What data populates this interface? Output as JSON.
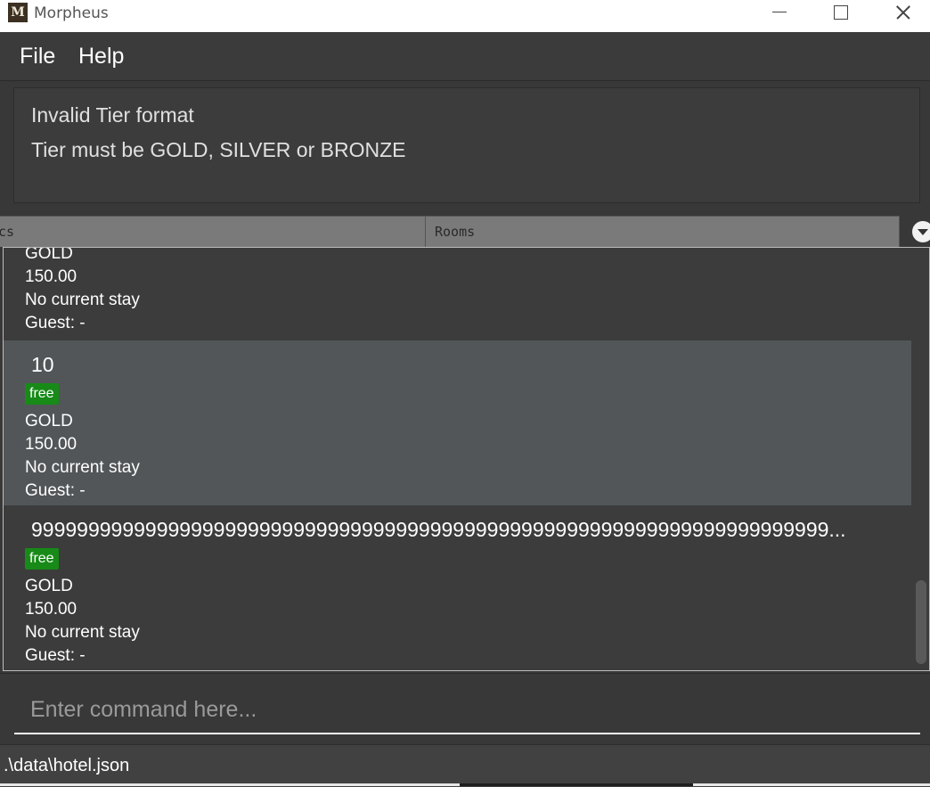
{
  "window": {
    "app_icon_letter": "M",
    "title": "Morpheus"
  },
  "menu": {
    "items": [
      {
        "label": "File"
      },
      {
        "label": "Help"
      }
    ]
  },
  "result": {
    "lines": [
      "Invalid Tier format",
      "Tier must be GOLD, SILVER or BRONZE"
    ]
  },
  "tabs": [
    {
      "label": "cs",
      "selected": false
    },
    {
      "label": "Rooms",
      "selected": true
    }
  ],
  "rooms": [
    {
      "number": "",
      "status": "",
      "tier": "GOLD",
      "price": "150.00",
      "stay": "No current stay",
      "guest": "Guest: -"
    },
    {
      "number": "10",
      "status": "free",
      "tier": "GOLD",
      "price": "150.00",
      "stay": "No current stay",
      "guest": "Guest: -",
      "selected": true
    },
    {
      "number": "9999999999999999999999999999999999999999999999999999999999999999999999...",
      "status": "free",
      "tier": "GOLD",
      "price": "150.00",
      "stay": "No current stay",
      "guest": "Guest: -"
    }
  ],
  "command": {
    "placeholder": "Enter command here..."
  },
  "status": {
    "file_path": ".\\data\\hotel.json"
  },
  "colors": {
    "badge_free": "#178a17",
    "selected_card": "#525659",
    "background": "#383838"
  }
}
